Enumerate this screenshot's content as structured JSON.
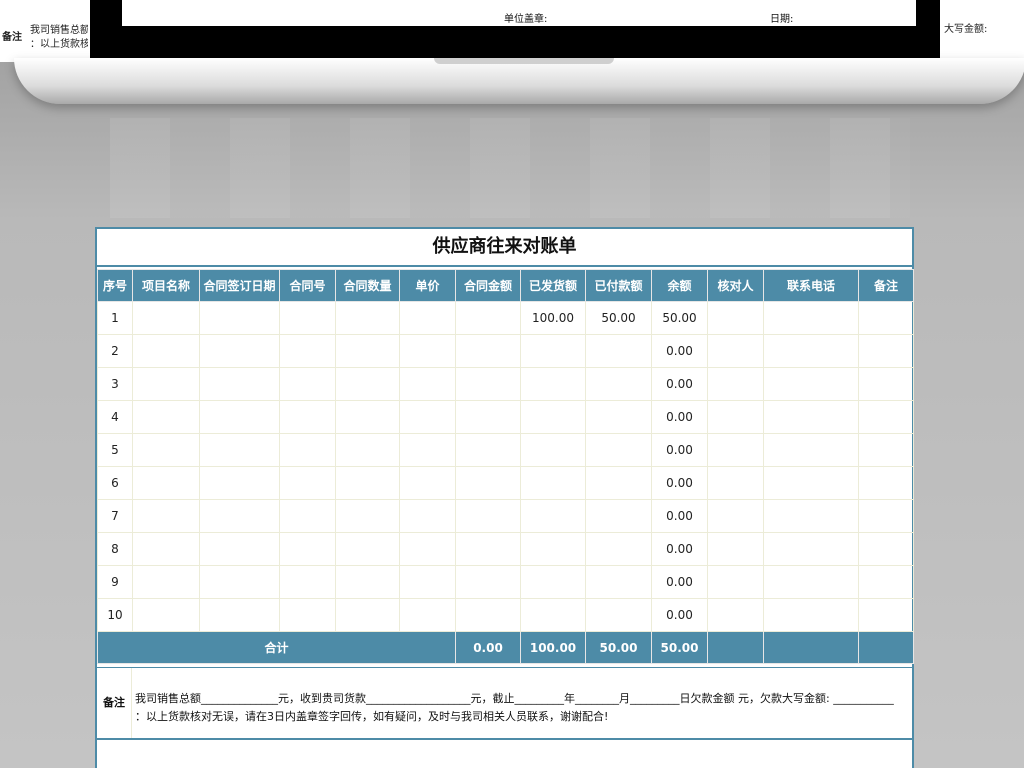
{
  "top": {
    "left_label": "备注",
    "left_text_line1": "我司销售总额",
    "left_text_line2": "：以上货款核",
    "seal_label": "单位盖章:",
    "date_label": "日期:",
    "right_text": "大写金额:"
  },
  "title": "供应商往来对账单",
  "columns": [
    "序号",
    "项目名称",
    "合同签订日期",
    "合同号",
    "合同数量",
    "单价",
    "合同金额",
    "已发货额",
    "已付款额",
    "余额",
    "核对人",
    "联系电话",
    "备注"
  ],
  "rows": [
    {
      "no": "1",
      "shipped": "100.00",
      "paid": "50.00",
      "balance": "50.00"
    },
    {
      "no": "2",
      "shipped": "",
      "paid": "",
      "balance": "0.00"
    },
    {
      "no": "3",
      "shipped": "",
      "paid": "",
      "balance": "0.00"
    },
    {
      "no": "4",
      "shipped": "",
      "paid": "",
      "balance": "0.00"
    },
    {
      "no": "5",
      "shipped": "",
      "paid": "",
      "balance": "0.00"
    },
    {
      "no": "6",
      "shipped": "",
      "paid": "",
      "balance": "0.00"
    },
    {
      "no": "7",
      "shipped": "",
      "paid": "",
      "balance": "0.00"
    },
    {
      "no": "8",
      "shipped": "",
      "paid": "",
      "balance": "0.00"
    },
    {
      "no": "9",
      "shipped": "",
      "paid": "",
      "balance": "0.00"
    },
    {
      "no": "10",
      "shipped": "",
      "paid": "",
      "balance": "0.00"
    }
  ],
  "total": {
    "label": "合计",
    "contract_amount": "0.00",
    "shipped": "100.00",
    "paid": "50.00",
    "balance": "50.00"
  },
  "notes": {
    "label": "备注",
    "line1": "我司销售总额______________元，收到贵司货款___________________元，截止_________年________月_________日欠款金额        元，欠款大写金额: ___________",
    "line2": "：以上货款核对无误，请在3日内盖章签字回传，如有疑问，及时与我司相关人员联系，谢谢配合!"
  },
  "colors": {
    "accent": "#4d8ba7"
  }
}
